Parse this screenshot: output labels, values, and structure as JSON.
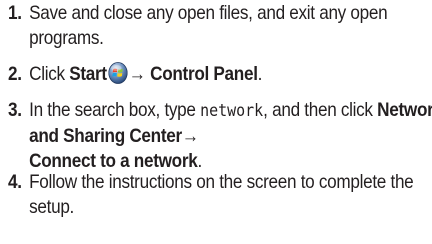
{
  "steps": [
    {
      "number": "1.",
      "text": "Save and close any open files, and exit any open programs."
    },
    {
      "number": "2.",
      "click_text": "Click ",
      "start_label": "Start",
      "arrow": "→",
      "control_panel_label": "Control Panel",
      "end": ".",
      "icon": "windows-start-orb-icon"
    },
    {
      "number": "3.",
      "text_before": "In the search box, type ",
      "typed_text": "network",
      "text_middle": ", and then click ",
      "nsc_label": "Network and Sharing Center",
      "arrow": "→",
      "connect_label": "Connect to a network",
      "end": "."
    },
    {
      "number": "4.",
      "text": "Follow the instructions on the screen to complete the setup."
    }
  ]
}
